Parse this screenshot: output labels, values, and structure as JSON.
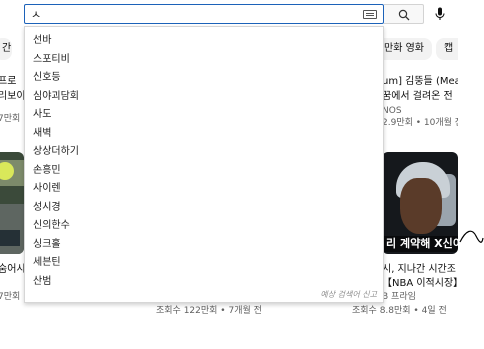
{
  "search": {
    "query": "ㅅ"
  },
  "suggestions": [
    "선바",
    "스포티비",
    "신호등",
    "심야괴담회",
    "사도",
    "새벽",
    "상상더하기",
    "손흥민",
    "사이렌",
    "성시경",
    "신의한수",
    "싱크홀",
    "세븐틴",
    "산범"
  ],
  "report_link": "예상 검색어 신고",
  "background": {
    "chips": {
      "left": "간",
      "right_1": "만화 영화",
      "right_2": "캡"
    },
    "left_video": {
      "title_1": "프로",
      "title_2": "리보이",
      "meta": "7만회",
      "bottom_title": "숨어시",
      "bottom_meta": "7만회"
    },
    "right_video": {
      "title_1": "um] 김뚱들 (Mear",
      "title_2": "꿈에서 걸려온 전",
      "channel": "NOS",
      "meta": "2.9만회 • 10개월 전",
      "thumb_caption": "리 계약해 X신이",
      "bottom_title": "시, 지나간 시간조",
      "bottom_title_2": "【NBA 이적시장】",
      "bottom_channel": "B 프라임",
      "bottom_meta": "조회수 8.8만회 • 4일 전"
    },
    "middle_meta": "조회수 122만회 • 7개월 전"
  }
}
